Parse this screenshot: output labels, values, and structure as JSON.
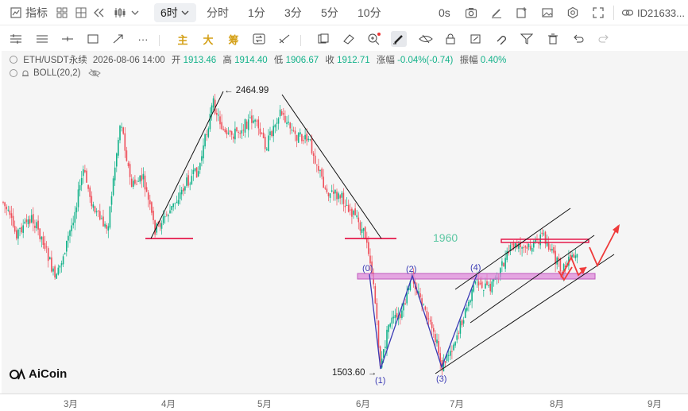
{
  "toolbar": {
    "indicator_label": "指标",
    "timeframes": [
      "6时",
      "分时",
      "1分",
      "3分",
      "5分",
      "10分"
    ],
    "active_timeframe": "6时",
    "seconds_label": "0s",
    "user_id": "ID21633..."
  },
  "draw_toolbar": {
    "main_label": "主",
    "big_label": "大",
    "chip_label": "筹"
  },
  "info": {
    "symbol": "ETH/USDT永续",
    "datetime": "2026-08-06 14:00",
    "open_label": "开",
    "open": "1913.46",
    "high_label": "高",
    "high": "1914.40",
    "low_label": "低",
    "low": "1906.67",
    "close_label": "收",
    "close": "1912.71",
    "change_label": "涨幅",
    "change": "-0.04%(-0.74)",
    "amplitude_label": "振幅",
    "amplitude": "0.40%",
    "indicator": "BOLL(20,2)"
  },
  "annotations": {
    "peak_price": "2464.99",
    "low_price": "1503.60",
    "level_text": "1960",
    "wave_labels": [
      "(0)",
      "(1)",
      "(2)",
      "(3)",
      "(4)"
    ]
  },
  "x_axis": {
    "ticks": [
      "3月",
      "4月",
      "5月",
      "6月",
      "7月",
      "8月",
      "9月"
    ]
  },
  "brand": {
    "name": "AiCoin"
  },
  "colors": {
    "up": "#13b28a",
    "down": "#ef4f5a",
    "support_line": "#e5194b",
    "zone_fill": "#dd8ad9",
    "wave_line": "#3b3bb5",
    "arrow": "#ef3b3b",
    "level_text": "#5cc7a3"
  }
}
